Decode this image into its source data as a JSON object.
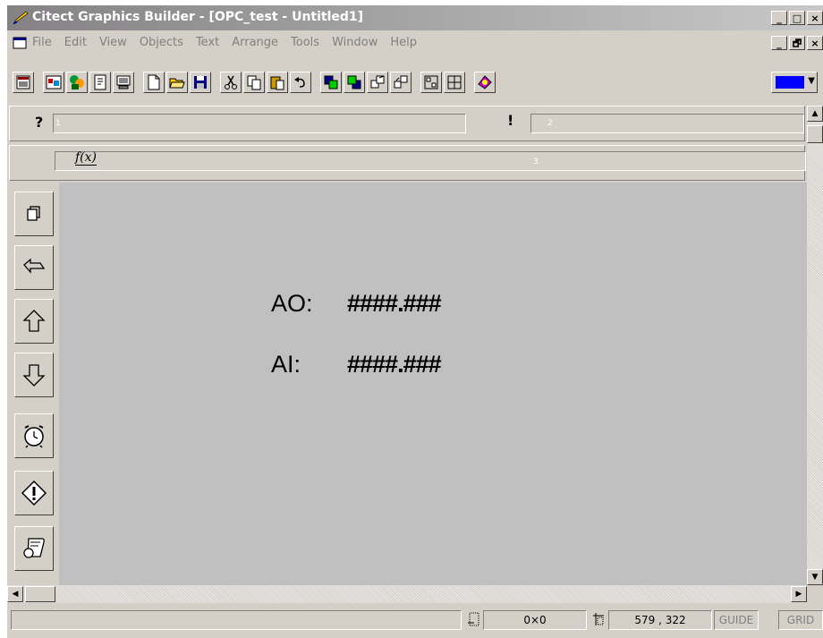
{
  "window": {
    "title": "Citect Graphics Builder - [OPC_test - Untitled1]",
    "buttons": [
      "_",
      "□",
      "×"
    ],
    "mdi_buttons": [
      "_",
      "🗗",
      "×"
    ]
  },
  "menu": {
    "items": [
      "File",
      "Edit",
      "View",
      "Objects",
      "Text",
      "Arrange",
      "Tools",
      "Window",
      "Help"
    ]
  },
  "toolbar": {
    "icons": [
      "project-editor-icon",
      "graphics-builder-icon",
      "cicode-editor-icon",
      "page-properties-icon",
      "computer-icon",
      "new-icon",
      "open-icon",
      "save-icon",
      "cut-icon",
      "copy-icon",
      "paste-icon",
      "undo-icon",
      "bring-to-front-icon",
      "send-to-back-icon",
      "group-icon",
      "ungroup-icon",
      "align-icon",
      "space-evenly-icon",
      "help-icon"
    ],
    "fill_color": "#0000ff"
  },
  "properties": {
    "query_label": "?",
    "exclaim_label": "!",
    "marker1": "1",
    "marker2": "2",
    "function_label": "f(x)",
    "marker3": "3"
  },
  "sidebar": {
    "buttons": [
      "copy-pages-icon",
      "back-icon",
      "up-arrow-icon",
      "down-arrow-icon",
      "alarm-clock-icon",
      "warning-icon",
      "scroll-icon"
    ]
  },
  "canvas": {
    "background": "#c0c0c0",
    "line1_label": "AO:",
    "line1_value": "####.###",
    "line2_label": "AI:",
    "line2_value": "####.###"
  },
  "status": {
    "size": "0×0",
    "coords": "579 , 322",
    "guide": "GUIDE",
    "grid": "GRID"
  }
}
